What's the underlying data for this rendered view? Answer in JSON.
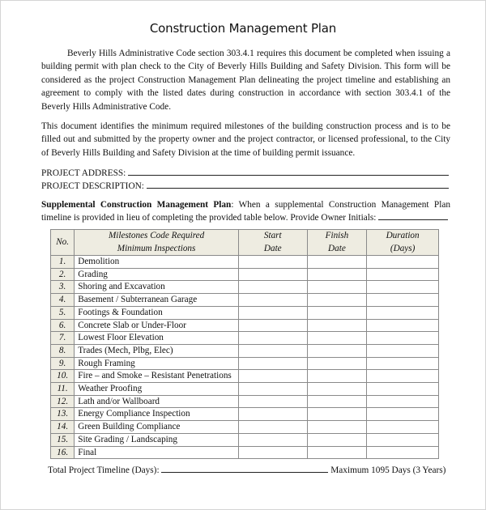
{
  "document": {
    "title": "Construction Management Plan",
    "paragraph1": "Beverly Hills Administrative Code section 303.4.1 requires this document be completed when issuing a building permit with plan check to the City of Beverly Hills Building and Safety Division.  This form will be considered as the project Construction Management Plan delineating the project timeline and establishing an agreement to comply with the listed dates during construction in accordance with section 303.4.1 of the Beverly Hills Administrative Code.",
    "paragraph2": "This document identifies the minimum required milestones of the building construction process and is to be filled out and submitted by the property owner and the project contractor, or licensed professional, to the City of Beverly Hills Building and Safety Division at the time of building permit issuance.",
    "fields": {
      "project_address_label": "PROJECT ADDRESS:",
      "project_address_value": "",
      "project_description_label": "PROJECT DESCRIPTION:",
      "project_description_value": ""
    },
    "supplemental": {
      "heading": "Supplemental Construction Management Plan",
      "text": ": When a supplemental Construction Management Plan timeline is provided in lieu of completing the provided table below. Provide Owner Initials:",
      "owner_initials_value": ""
    },
    "table": {
      "headers": {
        "no": "No.",
        "milestone_line1": "Milestones Code Required",
        "milestone_line2": "Minimum Inspections",
        "start_line1": "Start",
        "start_line2": "Date",
        "finish_line1": "Finish",
        "finish_line2": "Date",
        "duration_line1": "Duration",
        "duration_line2": "(Days)"
      },
      "rows": [
        {
          "no": "1.",
          "milestone": "Demolition",
          "start": "",
          "finish": "",
          "duration": ""
        },
        {
          "no": "2.",
          "milestone": "Grading",
          "start": "",
          "finish": "",
          "duration": ""
        },
        {
          "no": "3.",
          "milestone": "Shoring and Excavation",
          "start": "",
          "finish": "",
          "duration": ""
        },
        {
          "no": "4.",
          "milestone": "Basement / Subterranean Garage",
          "start": "",
          "finish": "",
          "duration": ""
        },
        {
          "no": "5.",
          "milestone": "Footings & Foundation",
          "start": "",
          "finish": "",
          "duration": ""
        },
        {
          "no": "6.",
          "milestone": "Concrete Slab or Under-Floor",
          "start": "",
          "finish": "",
          "duration": ""
        },
        {
          "no": "7.",
          "milestone": "Lowest Floor Elevation",
          "start": "",
          "finish": "",
          "duration": ""
        },
        {
          "no": "8.",
          "milestone": "Trades (Mech, Plbg, Elec)",
          "start": "",
          "finish": "",
          "duration": ""
        },
        {
          "no": "9.",
          "milestone": "Rough Framing",
          "start": "",
          "finish": "",
          "duration": ""
        },
        {
          "no": "10.",
          "milestone": "Fire – and Smoke – Resistant Penetrations",
          "start": "",
          "finish": "",
          "duration": ""
        },
        {
          "no": "11.",
          "milestone": "Weather Proofing",
          "start": "",
          "finish": "",
          "duration": ""
        },
        {
          "no": "12.",
          "milestone": "Lath and/or Wallboard",
          "start": "",
          "finish": "",
          "duration": ""
        },
        {
          "no": "13.",
          "milestone": "Energy Compliance Inspection",
          "start": "",
          "finish": "",
          "duration": ""
        },
        {
          "no": "14.",
          "milestone": "Green Building Compliance",
          "start": "",
          "finish": "",
          "duration": ""
        },
        {
          "no": "15.",
          "milestone": "Site Grading / Landscaping",
          "start": "",
          "finish": "",
          "duration": ""
        },
        {
          "no": "16.",
          "milestone": "Final",
          "start": "",
          "finish": "",
          "duration": ""
        }
      ]
    },
    "total": {
      "label": "Total Project Timeline (Days):",
      "value": "",
      "max_note": "Maximum 1095 Days (3 Years)"
    },
    "colors": {
      "header_fill": "#eeece1",
      "table_border": "#8a8a8a",
      "page_border": "#d4d4d4"
    }
  }
}
